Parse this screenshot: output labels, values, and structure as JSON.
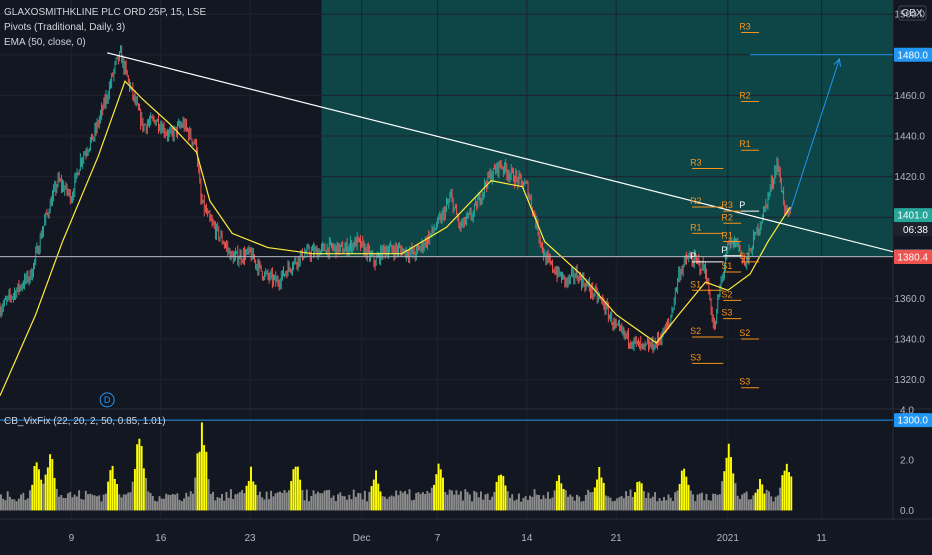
{
  "legend": {
    "symbol": "GLAXOSMITHKLINE PLC ORD 25P, 15, LSE",
    "pivots": "Pivots (Traditional, Daily, 3)",
    "ema": "EMA (50, close, 0)",
    "vix": "CB_VixFix (22, 20, 2, 50, 0.85, 1.01)",
    "currency": "GBX",
    "day_marker": "D"
  },
  "colors": {
    "background": "#131722",
    "candle_up": "#26a69a",
    "candle_down": "#ef5350",
    "ema": "#ffeb3b",
    "trendline": "#ffffff",
    "pivot_label": "#f7931a",
    "target_line": "#2196f3",
    "zone_fill": "#0e4d4d",
    "vix_high": "#ffff00",
    "vix_normal": "#8c8c8c"
  },
  "chart_data": {
    "type": "candlestick",
    "ylim": [
      1306,
      1507
    ],
    "x_tick_labels": [
      "9",
      "16",
      "23",
      "Dec",
      "7",
      "14",
      "21",
      "2021",
      "11"
    ],
    "y_tick_labels": [
      "1500.0",
      "1480.0",
      "1460.0",
      "1440.0",
      "1420.0",
      "1400.0",
      "1380.0",
      "1360.0",
      "1340.0",
      "1320.0",
      "1300.0"
    ],
    "price_badges": [
      {
        "label": "1480.0",
        "value": 1480.0,
        "color": "#2196f3"
      },
      {
        "label": "1401.0",
        "value": 1401.0,
        "color": "#26a69a"
      },
      {
        "label": "06:38",
        "value": 1394.0,
        "color": "#1e222d"
      },
      {
        "label": "1380.6",
        "value": 1380.6,
        "color": "#b2b5be"
      },
      {
        "label": "1380.4",
        "value": 1380.4,
        "color": "#ef5350"
      },
      {
        "label": "1300.0",
        "value": 1300.0,
        "color": "#2196f3"
      }
    ],
    "price_path": [
      [
        0,
        1355
      ],
      [
        7,
        1372
      ],
      [
        10,
        1398
      ],
      [
        13,
        1418
      ],
      [
        16,
        1410
      ],
      [
        18,
        1428
      ],
      [
        21,
        1440
      ],
      [
        24,
        1460
      ],
      [
        26,
        1476
      ],
      [
        27,
        1480
      ],
      [
        29,
        1465
      ],
      [
        32,
        1445
      ],
      [
        35,
        1448
      ],
      [
        38,
        1440
      ],
      [
        41,
        1446
      ],
      [
        44,
        1435
      ],
      [
        45,
        1408
      ],
      [
        47,
        1398
      ],
      [
        50,
        1388
      ],
      [
        52,
        1380
      ],
      [
        56,
        1382
      ],
      [
        59,
        1372
      ],
      [
        62,
        1368
      ],
      [
        65,
        1376
      ],
      [
        68,
        1382
      ],
      [
        71,
        1383
      ],
      [
        74,
        1385
      ],
      [
        77,
        1384
      ],
      [
        80,
        1388
      ],
      [
        84,
        1378
      ],
      [
        86,
        1384
      ],
      [
        89,
        1384
      ],
      [
        93,
        1382
      ],
      [
        96,
        1390
      ],
      [
        99,
        1400
      ],
      [
        101,
        1410
      ],
      [
        103,
        1395
      ],
      [
        106,
        1402
      ],
      [
        109,
        1418
      ],
      [
        112,
        1426
      ],
      [
        115,
        1420
      ],
      [
        118,
        1415
      ],
      [
        120,
        1398
      ],
      [
        122,
        1380
      ],
      [
        125,
        1372
      ],
      [
        127,
        1368
      ],
      [
        129,
        1372
      ],
      [
        132,
        1365
      ],
      [
        135,
        1358
      ],
      [
        138,
        1345
      ],
      [
        141,
        1340
      ],
      [
        144,
        1335
      ],
      [
        147,
        1338
      ],
      [
        150,
        1348
      ],
      [
        152,
        1372
      ],
      [
        154,
        1380
      ],
      [
        156,
        1378
      ],
      [
        158,
        1374
      ],
      [
        160,
        1344
      ],
      [
        161,
        1362
      ],
      [
        163,
        1385
      ],
      [
        165,
        1388
      ],
      [
        167,
        1376
      ],
      [
        169,
        1390
      ],
      [
        171,
        1402
      ],
      [
        173,
        1418
      ],
      [
        174,
        1427
      ],
      [
        175,
        1415
      ],
      [
        176,
        1402
      ],
      [
        177,
        1400
      ]
    ],
    "ema_path": [
      [
        0,
        1312
      ],
      [
        8,
        1352
      ],
      [
        14,
        1388
      ],
      [
        22,
        1430
      ],
      [
        28,
        1467
      ],
      [
        32,
        1458
      ],
      [
        38,
        1446
      ],
      [
        44,
        1432
      ],
      [
        47,
        1408
      ],
      [
        52,
        1392
      ],
      [
        60,
        1385
      ],
      [
        70,
        1382
      ],
      [
        80,
        1382
      ],
      [
        90,
        1382
      ],
      [
        100,
        1395
      ],
      [
        110,
        1418
      ],
      [
        117,
        1415
      ],
      [
        122,
        1388
      ],
      [
        130,
        1372
      ],
      [
        138,
        1352
      ],
      [
        147,
        1338
      ],
      [
        152,
        1352
      ],
      [
        158,
        1368
      ],
      [
        163,
        1364
      ],
      [
        168,
        1372
      ],
      [
        172,
        1388
      ],
      [
        177,
        1405
      ]
    ],
    "trendline": {
      "from": [
        24,
        1481
      ],
      "to": [
        200,
        1383
      ]
    },
    "horizontal_levels": [
      {
        "value": 1380.6,
        "from_idx": 0,
        "color": "#b2b5be"
      },
      {
        "value": 1480.0,
        "from_idx": 168,
        "color": "#2196f3"
      },
      {
        "value": 1300.0,
        "from_idx": 0,
        "color": "#2196f3"
      }
    ],
    "target_arrow": {
      "from": [
        177,
        1403
      ],
      "to": [
        188,
        1478
      ]
    },
    "shaded_zone": {
      "from_idx": 72,
      "y_top": 1507,
      "y_bottom": 1380.6
    },
    "pivots": [
      {
        "from": 155,
        "to": 162,
        "levels": [
          {
            "name": "R3",
            "value": 1424
          },
          {
            "name": "R2",
            "value": 1405
          },
          {
            "name": "R1",
            "value": 1392
          },
          {
            "name": "P",
            "value": 1378
          },
          {
            "name": "S1",
            "value": 1364
          },
          {
            "name": "S2",
            "value": 1341
          },
          {
            "name": "S3",
            "value": 1328
          }
        ]
      },
      {
        "from": 162,
        "to": 166,
        "levels": [
          {
            "name": "R3",
            "value": 1403
          },
          {
            "name": "R2",
            "value": 1397
          },
          {
            "name": "R1",
            "value": 1388
          },
          {
            "name": "P",
            "value": 1381
          },
          {
            "name": "S1",
            "value": 1373
          },
          {
            "name": "S2",
            "value": 1359
          },
          {
            "name": "S3",
            "value": 1350
          }
        ]
      },
      {
        "from": 166,
        "to": 170,
        "levels": [
          {
            "name": "R3",
            "value": 1491
          },
          {
            "name": "R2",
            "value": 1457
          },
          {
            "name": "R1",
            "value": 1433
          },
          {
            "name": "P",
            "value": 1403
          },
          {
            "name": "S1",
            "value": 1378
          },
          {
            "name": "S2",
            "value": 1340
          },
          {
            "name": "S3",
            "value": 1316
          }
        ]
      }
    ],
    "vix": {
      "ylim": [
        -0.3,
        4.0
      ],
      "tick_labels": [
        "4.0",
        "2.0",
        "0.0"
      ],
      "tick_values": [
        4.0,
        2.0,
        0.0
      ],
      "spikes": [
        {
          "idx": 8,
          "value": 2.2
        },
        {
          "idx": 11,
          "value": 2.7
        },
        {
          "idx": 25,
          "value": 2.0
        },
        {
          "idx": 31,
          "value": 3.3
        },
        {
          "idx": 45,
          "value": 3.8
        },
        {
          "idx": 56,
          "value": 1.8
        },
        {
          "idx": 66,
          "value": 2.2
        },
        {
          "idx": 84,
          "value": 1.6
        },
        {
          "idx": 98,
          "value": 2.2
        },
        {
          "idx": 112,
          "value": 1.9
        },
        {
          "idx": 125,
          "value": 1.6
        },
        {
          "idx": 134,
          "value": 1.8
        },
        {
          "idx": 143,
          "value": 1.5
        },
        {
          "idx": 153,
          "value": 2.0
        },
        {
          "idx": 163,
          "value": 2.8
        },
        {
          "idx": 170,
          "value": 1.3
        },
        {
          "idx": 176,
          "value": 2.3
        }
      ]
    }
  }
}
